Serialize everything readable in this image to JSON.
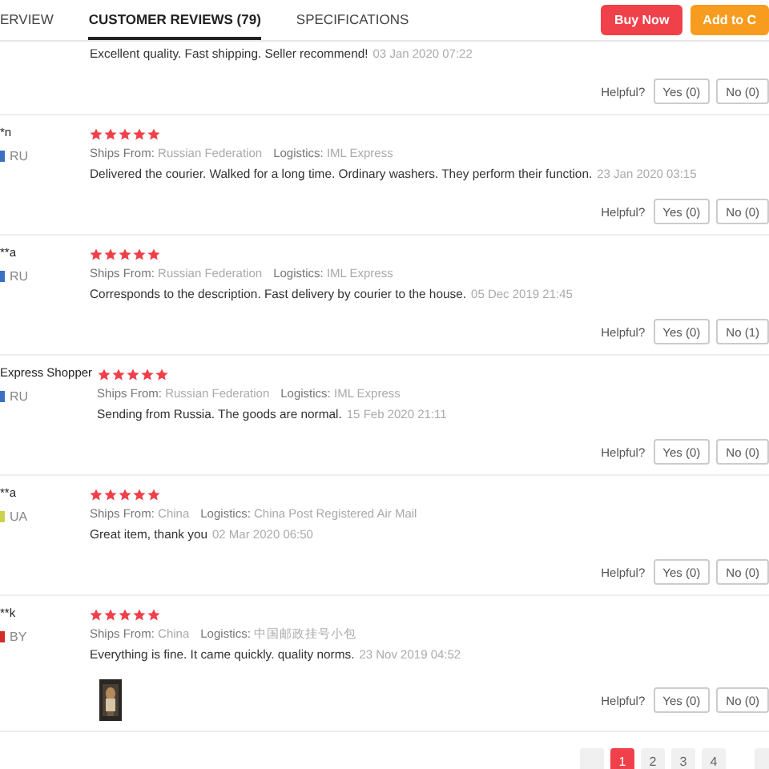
{
  "tabs": [
    {
      "label": "ERVIEW",
      "selected": false
    },
    {
      "label": "CUSTOMER REVIEWS (79)",
      "selected": true
    },
    {
      "label": "SPECIFICATIONS",
      "selected": false
    }
  ],
  "actions": [
    {
      "label": "Buy Now",
      "kind": "buy"
    },
    {
      "label": "Add to C",
      "kind": "cart"
    }
  ],
  "reviews": [
    {
      "text": "Excellent quality. Fast shipping. Seller recommend!",
      "date": "03 Jan 2020 07:22",
      "helpful": "Helpful?",
      "yes": "Yes (0)",
      "no": "No (0)"
    },
    {
      "user": "*n",
      "country": "RU",
      "color": "#3b6fc4",
      "stars": 5,
      "ships_label": "Ships From:",
      "ships_from": "Russian Federation",
      "logistics_label": "Logistics:",
      "logistics": "IML Express",
      "text": "Delivered the courier. Walked for a long time. Ordinary washers. They perform their function.",
      "date": "23 Jan 2020 03:15",
      "helpful": "Helpful?",
      "yes": "Yes (0)",
      "no": "No (0)"
    },
    {
      "user": "**a",
      "country": "RU",
      "color": "#3b6fc4",
      "stars": 5,
      "ships_label": "Ships From:",
      "ships_from": "Russian Federation",
      "logistics_label": "Logistics:",
      "logistics": "IML Express",
      "text": "Corresponds to the description. Fast delivery by courier to the house.",
      "date": "05 Dec 2019 21:45",
      "helpful": "Helpful?",
      "yes": "Yes (0)",
      "no": "No (1)"
    },
    {
      "user": "Express Shopper",
      "country": "RU",
      "color": "#3b6fc4",
      "stars": 5,
      "ships_label": "Ships From:",
      "ships_from": "Russian Federation",
      "logistics_label": "Logistics:",
      "logistics": "IML Express",
      "text": "Sending from Russia. The goods are normal.",
      "date": "15 Feb 2020 21:11",
      "helpful": "Helpful?",
      "yes": "Yes (0)",
      "no": "No (0)"
    },
    {
      "user": "**a",
      "country": "UA",
      "color": "#c9d24a",
      "stars": 5,
      "ships_label": "Ships From:",
      "ships_from": "China",
      "logistics_label": "Logistics:",
      "logistics": "China Post Registered Air Mail",
      "text": "Great item, thank you",
      "date": "02 Mar 2020 06:50",
      "helpful": "Helpful?",
      "yes": "Yes (0)",
      "no": "No (0)"
    },
    {
      "user": "**k",
      "country": "BY",
      "color": "#d42b2b",
      "stars": 5,
      "ships_label": "Ships From:",
      "ships_from": "China",
      "logistics_label": "Logistics:",
      "logistics": "中国邮政挂号小包",
      "text": "Everything is fine. It came quickly. quality norms.",
      "date": "23 Nov 2019 04:52",
      "helpful": "Helpful?",
      "yes": "Yes (0)",
      "no": "No (0)"
    }
  ],
  "pages": [
    {
      "label": "1",
      "selected": true
    },
    {
      "label": "2",
      "selected": false
    },
    {
      "label": "3",
      "selected": false
    },
    {
      "label": "4",
      "selected": false
    }
  ]
}
